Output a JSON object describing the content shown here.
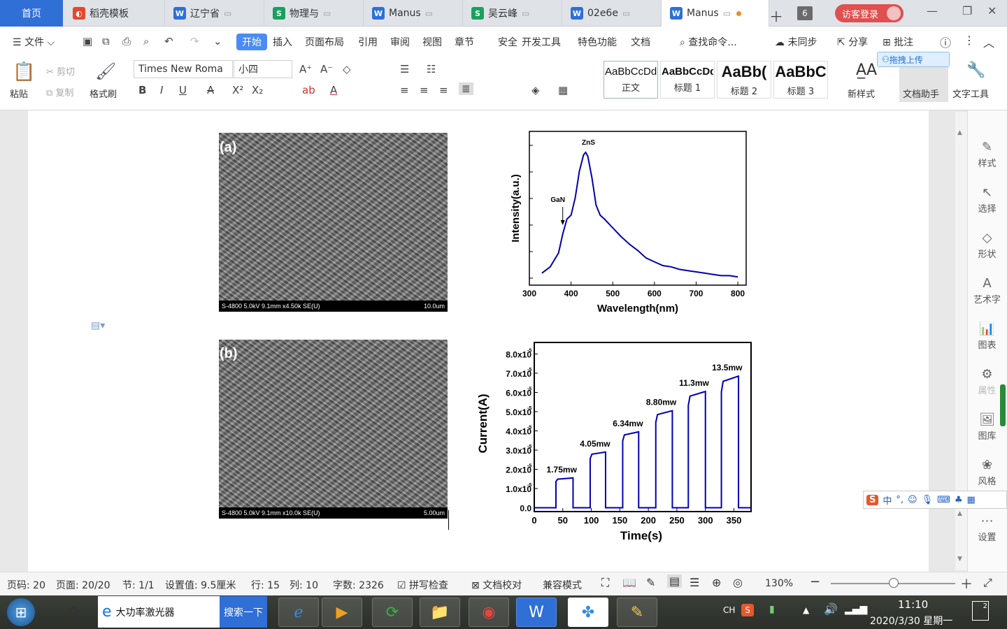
{
  "tabs": {
    "home": "首页",
    "items": [
      {
        "label": "稻壳模板",
        "kind": "d"
      },
      {
        "label": "辽宁省",
        "kind": "w"
      },
      {
        "label": "物理与",
        "kind": "s"
      },
      {
        "label": "Manus",
        "kind": "w"
      },
      {
        "label": "吴云峰",
        "kind": "s"
      },
      {
        "label": "02e6e",
        "kind": "w"
      },
      {
        "label": "Manus",
        "kind": "w",
        "active": true
      }
    ],
    "count": "6",
    "login": "访客登录"
  },
  "menu": {
    "file": "文件",
    "items": [
      "开始",
      "插入",
      "页面布局",
      "引用",
      "审阅",
      "视图",
      "章节",
      "安全",
      "开发工具",
      "特色功能",
      "文档"
    ],
    "search": "查找命令...",
    "sync": "未同步",
    "share": "分享",
    "annot": "批注",
    "upload": "拖拽上传"
  },
  "ribbon": {
    "paste": "粘贴",
    "cut": "剪切",
    "copy": "复制",
    "format_painter": "格式刷",
    "font": "Times New Roma",
    "size": "小四",
    "styles": [
      {
        "preview": "AaBbCcDd",
        "name": "正文"
      },
      {
        "preview": "AaBbCcDd",
        "name": "标题 1"
      },
      {
        "preview": "AaBb(",
        "name": "标题 2"
      },
      {
        "preview": "AaBbC",
        "name": "标题 3"
      }
    ],
    "new_style": "新样式",
    "doc_assist": "文档助手",
    "text_tool": "文字工具"
  },
  "sidebar": [
    "样式",
    "选择",
    "形状",
    "艺术字",
    "图表",
    "属性",
    "图库",
    "风格",
    "设置"
  ],
  "figures": {
    "a_label": "(a)",
    "a_bar_left": "S-4800 5.0kV 9.1mm x4.50k SE(U)",
    "a_bar_right": "10.0um",
    "b_label": "(b)",
    "b_bar_left": "S-4800 5.0kV 9.1mm x10.0k SE(U)",
    "b_bar_right": "5.00um"
  },
  "chart_data": [
    {
      "type": "line",
      "xlabel": "Wavelength(nm)",
      "ylabel": "Intensity(a.u.)",
      "xlim": [
        300,
        820
      ],
      "xticks": [
        300,
        400,
        500,
        600,
        700,
        800
      ],
      "annotations": [
        {
          "text": "ZnS",
          "x": 435
        },
        {
          "text": "GaN",
          "x": 380
        }
      ],
      "x": [
        330,
        350,
        370,
        380,
        390,
        400,
        410,
        420,
        430,
        435,
        440,
        450,
        460,
        470,
        480,
        500,
        520,
        540,
        560,
        580,
        600,
        620,
        640,
        660,
        680,
        700,
        720,
        740,
        760,
        780,
        800
      ],
      "y": [
        0.04,
        0.09,
        0.2,
        0.35,
        0.47,
        0.5,
        0.64,
        0.85,
        0.98,
        1.0,
        0.97,
        0.8,
        0.58,
        0.5,
        0.47,
        0.4,
        0.33,
        0.27,
        0.22,
        0.16,
        0.13,
        0.1,
        0.09,
        0.07,
        0.06,
        0.05,
        0.04,
        0.03,
        0.02,
        0.02,
        0.01
      ]
    },
    {
      "type": "line",
      "xlabel": "Time(s)",
      "ylabel": "Current(A)",
      "xlim": [
        0,
        380
      ],
      "ylim": [
        -0.2,
        8.6
      ],
      "xticks": [
        0,
        50,
        100,
        150,
        200,
        250,
        300,
        350
      ],
      "yticks": [
        "0.0",
        "1.0x10",
        "2.0x10",
        "3.0x10",
        "4.0x10",
        "5.0x10",
        "6.0x10",
        "7.0x10",
        "8.0x10"
      ],
      "ytick_exp": "-5",
      "pulses": [
        {
          "label": "1.75mw",
          "on": 38,
          "off": 68,
          "peak": 1.55
        },
        {
          "label": "4.05mw",
          "on": 98,
          "off": 125,
          "peak": 2.9
        },
        {
          "label": "6.34mw",
          "on": 155,
          "off": 183,
          "peak": 3.95
        },
        {
          "label": "8.80mw",
          "on": 213,
          "off": 242,
          "peak": 5.05
        },
        {
          "label": "11.3mw",
          "on": 270,
          "off": 300,
          "peak": 6.05
        },
        {
          "label": "13.5mw",
          "on": 328,
          "off": 358,
          "peak": 6.85
        }
      ]
    }
  ],
  "status": {
    "page": "页码: 20",
    "pages": "页面: 20/20",
    "section": "节: 1/1",
    "setting": "设置值: 9.5厘米",
    "row": "行: 15",
    "col": "列: 10",
    "words": "字数: 2326",
    "spell": "拼写检查",
    "proof": "文档校对",
    "compat": "兼容模式",
    "zoom": "130%"
  },
  "taskbar": {
    "browser_tab": "大功率激光器",
    "search_btn": "搜索一下",
    "lang": "CH",
    "time": "11:10",
    "date": "2020/3/30 星期一",
    "notif": "2"
  }
}
